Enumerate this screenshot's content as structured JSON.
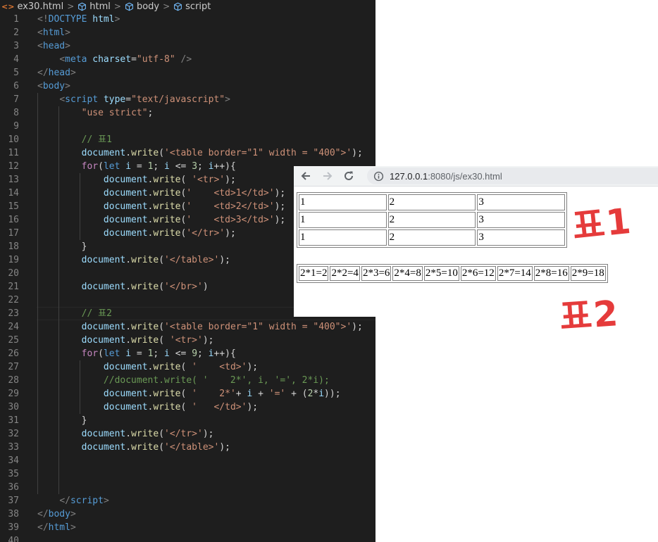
{
  "breadcrumb": {
    "file": "ex30.html",
    "items": [
      "html",
      "body",
      "script"
    ]
  },
  "editor": {
    "lines": [
      [
        [
          "punc",
          "<!"
        ],
        [
          "tag",
          "DOCTYPE"
        ],
        [
          "op",
          " "
        ],
        [
          "attr",
          "html"
        ],
        [
          "punc",
          ">"
        ]
      ],
      [
        [
          "punc",
          "<"
        ],
        [
          "tag",
          "html"
        ],
        [
          "punc",
          ">"
        ]
      ],
      [
        [
          "punc",
          "<"
        ],
        [
          "tag",
          "head"
        ],
        [
          "punc",
          ">"
        ]
      ],
      [
        [
          "op",
          "    "
        ],
        [
          "punc",
          "<"
        ],
        [
          "tag",
          "meta"
        ],
        [
          "op",
          " "
        ],
        [
          "attr",
          "charset"
        ],
        [
          "op",
          "="
        ],
        [
          "str",
          "\"utf-8\""
        ],
        [
          "op",
          " "
        ],
        [
          "punc",
          "/>"
        ]
      ],
      [
        [
          "punc",
          "</"
        ],
        [
          "tag",
          "head"
        ],
        [
          "punc",
          ">"
        ]
      ],
      [
        [
          "punc",
          "<"
        ],
        [
          "tag",
          "body"
        ],
        [
          "punc",
          ">"
        ]
      ],
      [
        [
          "op",
          "    "
        ],
        [
          "punc",
          "<"
        ],
        [
          "tag",
          "script"
        ],
        [
          "op",
          " "
        ],
        [
          "attr",
          "type"
        ],
        [
          "op",
          "="
        ],
        [
          "str",
          "\"text/javascript\""
        ],
        [
          "punc",
          ">"
        ]
      ],
      [
        [
          "op",
          "        "
        ],
        [
          "str",
          "\"use strict\""
        ],
        [
          "op",
          ";"
        ]
      ],
      [],
      [
        [
          "op",
          "        "
        ],
        [
          "com",
          "// 표1"
        ]
      ],
      [
        [
          "op",
          "        "
        ],
        [
          "var",
          "document"
        ],
        [
          "op",
          "."
        ],
        [
          "func",
          "write"
        ],
        [
          "op",
          "("
        ],
        [
          "str",
          "'<table border=\"1\" width = \"400\">'"
        ],
        [
          "op",
          ");"
        ]
      ],
      [
        [
          "op",
          "        "
        ],
        [
          "kw",
          "for"
        ],
        [
          "op",
          "("
        ],
        [
          "decl",
          "let"
        ],
        [
          "op",
          " "
        ],
        [
          "var",
          "i"
        ],
        [
          "op",
          " = "
        ],
        [
          "num",
          "1"
        ],
        [
          "op",
          "; "
        ],
        [
          "var",
          "i"
        ],
        [
          "op",
          " <= "
        ],
        [
          "num",
          "3"
        ],
        [
          "op",
          "; "
        ],
        [
          "var",
          "i"
        ],
        [
          "op",
          "++){"
        ]
      ],
      [
        [
          "op",
          "            "
        ],
        [
          "var",
          "document"
        ],
        [
          "op",
          "."
        ],
        [
          "func",
          "write"
        ],
        [
          "op",
          "( "
        ],
        [
          "str",
          "'<tr>'"
        ],
        [
          "op",
          ");"
        ]
      ],
      [
        [
          "op",
          "            "
        ],
        [
          "var",
          "document"
        ],
        [
          "op",
          "."
        ],
        [
          "func",
          "write"
        ],
        [
          "op",
          "("
        ],
        [
          "str",
          "'    <td>1</td>'"
        ],
        [
          "op",
          ");"
        ]
      ],
      [
        [
          "op",
          "            "
        ],
        [
          "var",
          "document"
        ],
        [
          "op",
          "."
        ],
        [
          "func",
          "write"
        ],
        [
          "op",
          "("
        ],
        [
          "str",
          "'    <td>2</td>'"
        ],
        [
          "op",
          ");"
        ]
      ],
      [
        [
          "op",
          "            "
        ],
        [
          "var",
          "document"
        ],
        [
          "op",
          "."
        ],
        [
          "func",
          "write"
        ],
        [
          "op",
          "("
        ],
        [
          "str",
          "'    <td>3</td>'"
        ],
        [
          "op",
          ");"
        ]
      ],
      [
        [
          "op",
          "            "
        ],
        [
          "var",
          "document"
        ],
        [
          "op",
          "."
        ],
        [
          "func",
          "write"
        ],
        [
          "op",
          "("
        ],
        [
          "str",
          "'</tr>'"
        ],
        [
          "op",
          ");"
        ]
      ],
      [
        [
          "op",
          "        }"
        ]
      ],
      [
        [
          "op",
          "        "
        ],
        [
          "var",
          "document"
        ],
        [
          "op",
          "."
        ],
        [
          "func",
          "write"
        ],
        [
          "op",
          "("
        ],
        [
          "str",
          "'</table>'"
        ],
        [
          "op",
          ");"
        ]
      ],
      [],
      [
        [
          "op",
          "        "
        ],
        [
          "var",
          "document"
        ],
        [
          "op",
          "."
        ],
        [
          "func",
          "write"
        ],
        [
          "op",
          "("
        ],
        [
          "str",
          "'</br>'"
        ],
        [
          "op",
          ")"
        ]
      ],
      [],
      [
        [
          "op",
          "        "
        ],
        [
          "com",
          "// 표2"
        ]
      ],
      [
        [
          "op",
          "        "
        ],
        [
          "var",
          "document"
        ],
        [
          "op",
          "."
        ],
        [
          "func",
          "write"
        ],
        [
          "op",
          "("
        ],
        [
          "str",
          "'<table border=\"1\" width = \"400\">'"
        ],
        [
          "op",
          ");"
        ]
      ],
      [
        [
          "op",
          "        "
        ],
        [
          "var",
          "document"
        ],
        [
          "op",
          "."
        ],
        [
          "func",
          "write"
        ],
        [
          "op",
          "( "
        ],
        [
          "str",
          "'<tr>'"
        ],
        [
          "op",
          ");"
        ]
      ],
      [
        [
          "op",
          "        "
        ],
        [
          "kw",
          "for"
        ],
        [
          "op",
          "("
        ],
        [
          "decl",
          "let"
        ],
        [
          "op",
          " "
        ],
        [
          "var",
          "i"
        ],
        [
          "op",
          " = "
        ],
        [
          "num",
          "1"
        ],
        [
          "op",
          "; "
        ],
        [
          "var",
          "i"
        ],
        [
          "op",
          " <= "
        ],
        [
          "num",
          "9"
        ],
        [
          "op",
          "; "
        ],
        [
          "var",
          "i"
        ],
        [
          "op",
          "++){"
        ]
      ],
      [
        [
          "op",
          "            "
        ],
        [
          "var",
          "document"
        ],
        [
          "op",
          "."
        ],
        [
          "func",
          "write"
        ],
        [
          "op",
          "( "
        ],
        [
          "str",
          "'    <td>'"
        ],
        [
          "op",
          ");"
        ]
      ],
      [
        [
          "op",
          "            "
        ],
        [
          "com",
          "//document.write( '    2*', i, '=', 2*i);"
        ]
      ],
      [
        [
          "op",
          "            "
        ],
        [
          "var",
          "document"
        ],
        [
          "op",
          "."
        ],
        [
          "func",
          "write"
        ],
        [
          "op",
          "( "
        ],
        [
          "str",
          "'    2*'"
        ],
        [
          "op",
          "+ "
        ],
        [
          "var",
          "i"
        ],
        [
          "op",
          " + "
        ],
        [
          "str",
          "'='"
        ],
        [
          "op",
          " + ("
        ],
        [
          "num",
          "2"
        ],
        [
          "op",
          "*"
        ],
        [
          "var",
          "i"
        ],
        [
          "op",
          "));"
        ]
      ],
      [
        [
          "op",
          "            "
        ],
        [
          "var",
          "document"
        ],
        [
          "op",
          "."
        ],
        [
          "func",
          "write"
        ],
        [
          "op",
          "( "
        ],
        [
          "str",
          "'   </td>'"
        ],
        [
          "op",
          ");"
        ]
      ],
      [
        [
          "op",
          "        }"
        ]
      ],
      [
        [
          "op",
          "        "
        ],
        [
          "var",
          "document"
        ],
        [
          "op",
          "."
        ],
        [
          "func",
          "write"
        ],
        [
          "op",
          "("
        ],
        [
          "str",
          "'</tr>'"
        ],
        [
          "op",
          ");"
        ]
      ],
      [
        [
          "op",
          "        "
        ],
        [
          "var",
          "document"
        ],
        [
          "op",
          "."
        ],
        [
          "func",
          "write"
        ],
        [
          "op",
          "("
        ],
        [
          "str",
          "'</table>'"
        ],
        [
          "op",
          ");"
        ]
      ],
      [],
      [],
      [],
      [
        [
          "op",
          "    "
        ],
        [
          "punc",
          "</"
        ],
        [
          "tag",
          "script"
        ],
        [
          "punc",
          ">"
        ]
      ],
      [
        [
          "punc",
          "</"
        ],
        [
          "tag",
          "body"
        ],
        [
          "punc",
          ">"
        ]
      ],
      [
        [
          "punc",
          "</"
        ],
        [
          "tag",
          "html"
        ],
        [
          "punc",
          ">"
        ]
      ],
      []
    ],
    "colors": {
      "punc": "#808080",
      "tag": "#569cd6",
      "attr": "#9cdcfe",
      "str": "#ce9178",
      "kw": "#c586c0",
      "decl": "#569cd6",
      "var": "#9cdcfe",
      "num": "#b5cea8",
      "func": "#dcdcaa",
      "com": "#6a9955",
      "op": "#d4d4d4"
    }
  },
  "browser": {
    "url_host": "127.0.0.1",
    "url_port": ":8080",
    "url_path": "/js/ex30.html",
    "table1": [
      [
        "1",
        "2",
        "3"
      ],
      [
        "1",
        "2",
        "3"
      ],
      [
        "1",
        "2",
        "3"
      ]
    ],
    "table2": [
      "2*1=2",
      "2*2=4",
      "2*3=6",
      "2*4=8",
      "2*5=10",
      "2*6=12",
      "2*7=14",
      "2*8=16",
      "2*9=18"
    ]
  },
  "annotations": {
    "label1": "표1",
    "label2": "표2",
    "color": "#e32b2b"
  }
}
